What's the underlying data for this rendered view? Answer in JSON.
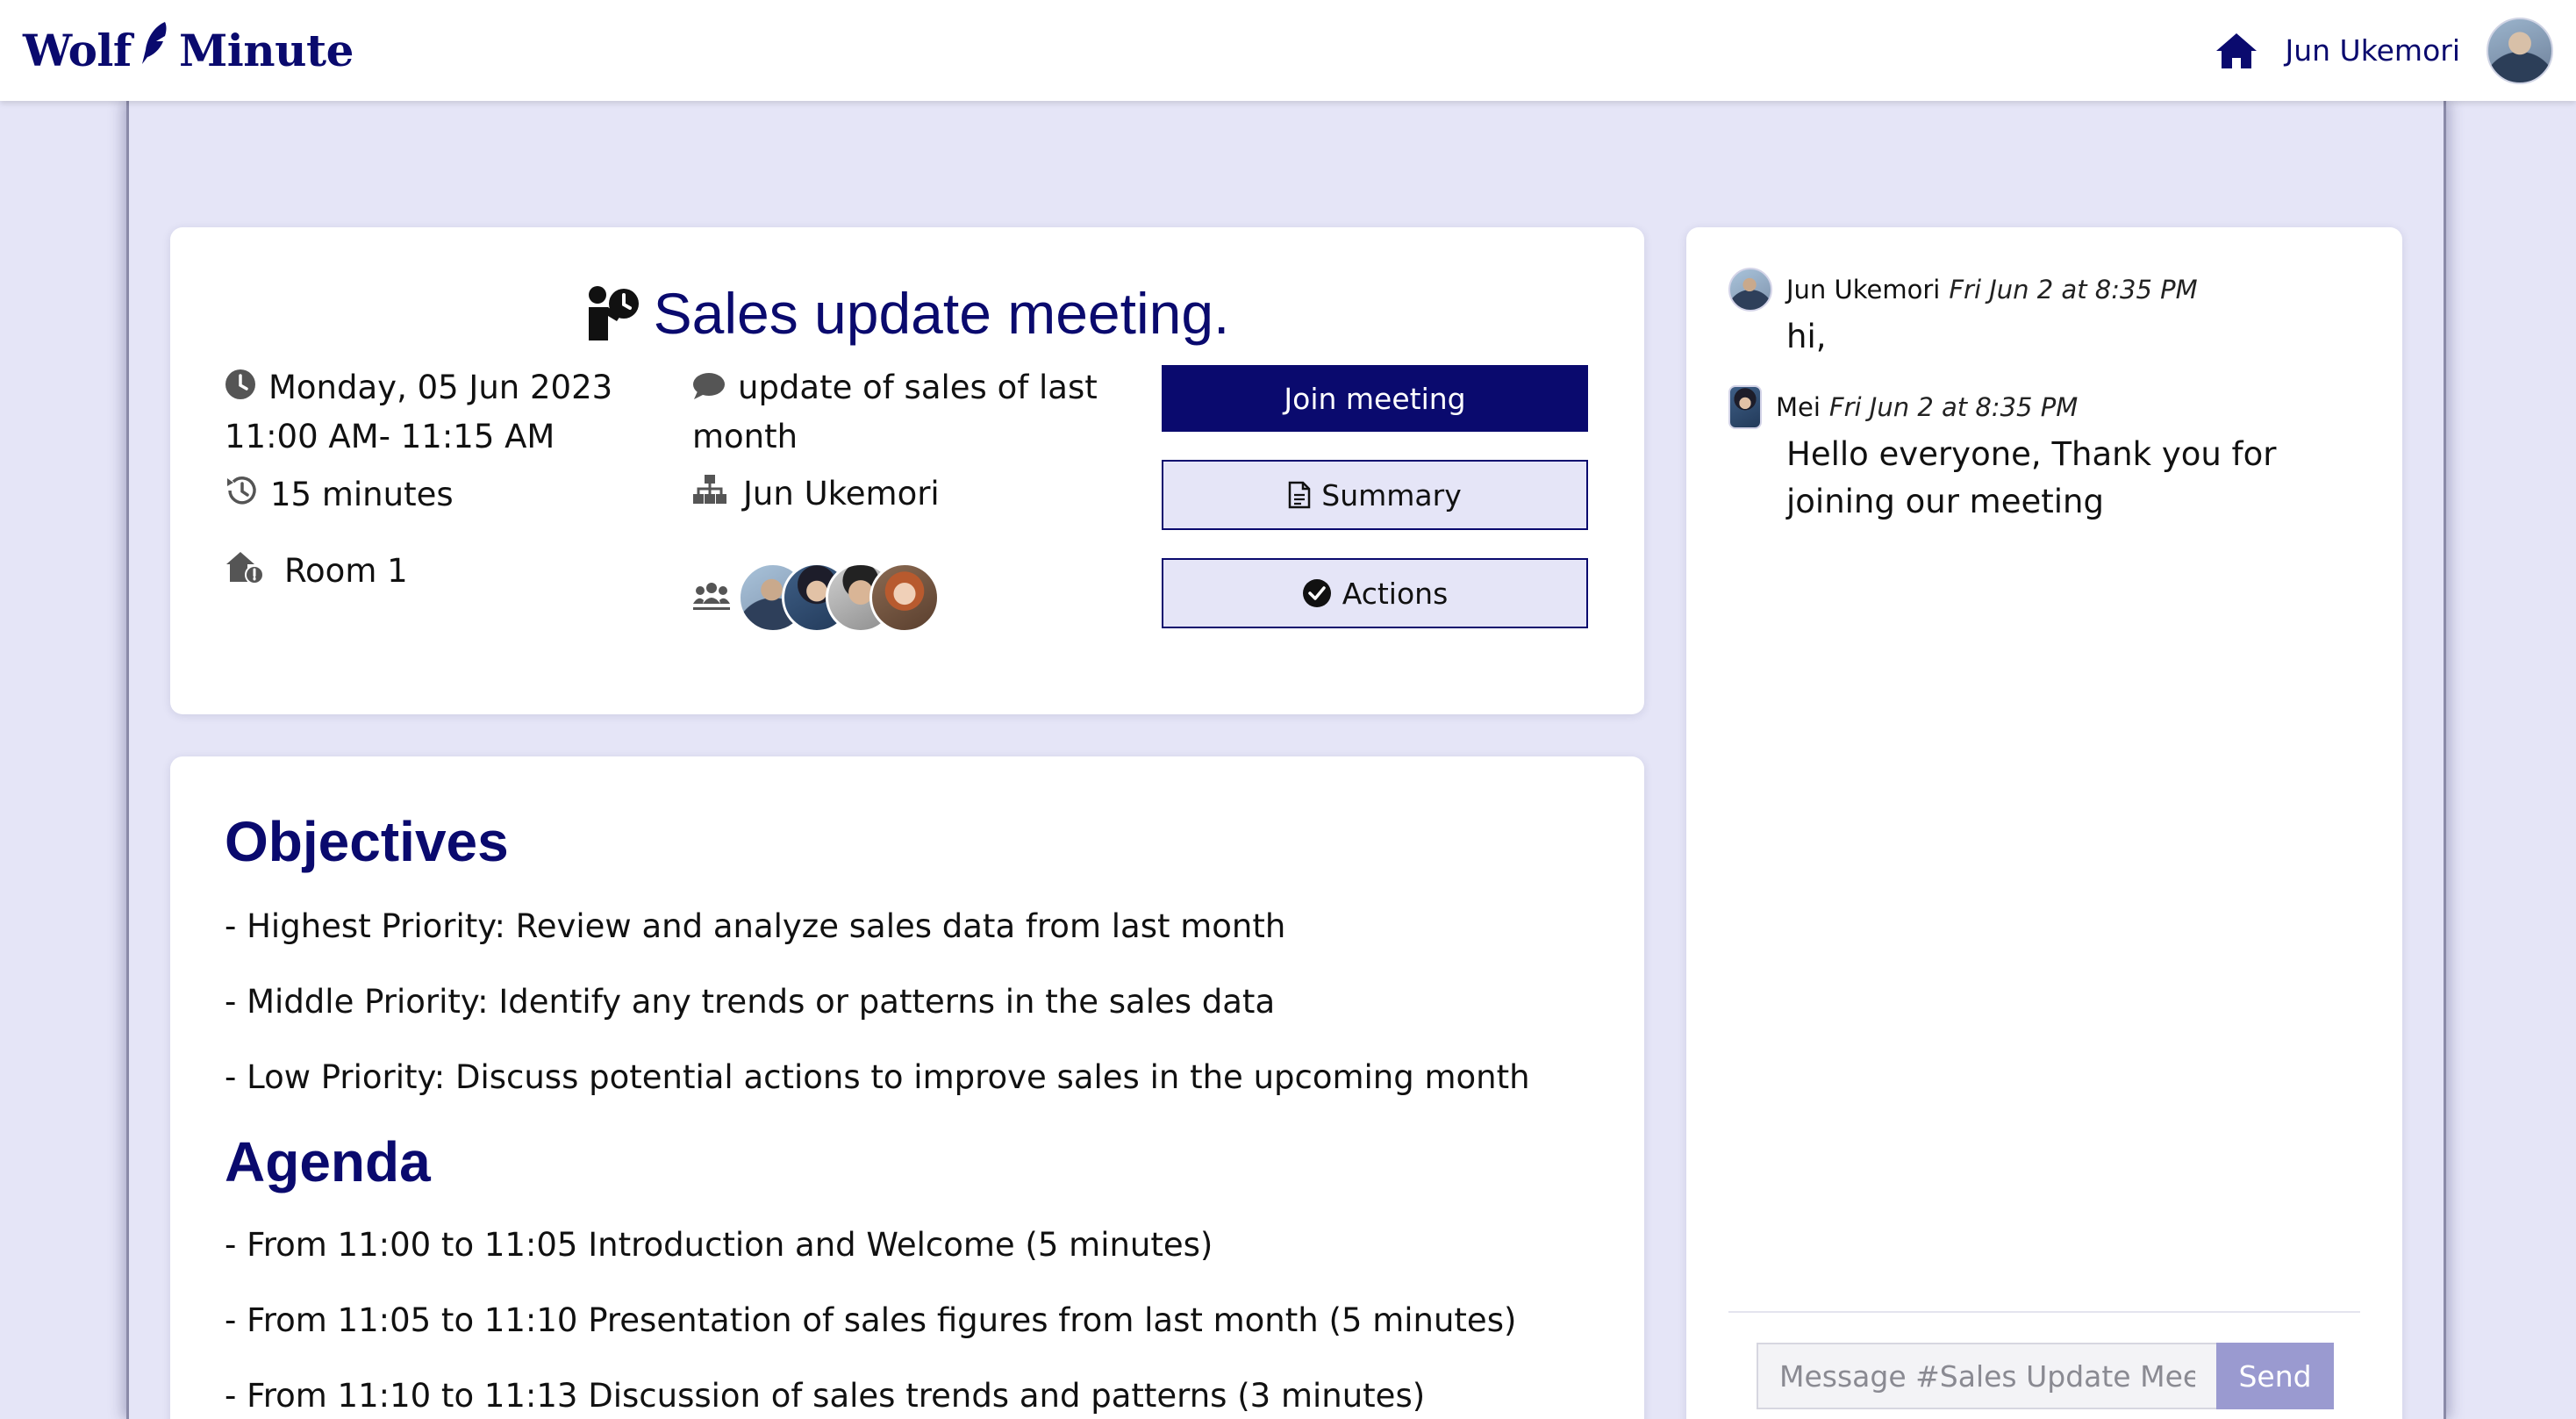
{
  "brand": {
    "name_left": "Wolf",
    "name_right": "Minute"
  },
  "nav": {
    "user_name": "Jun Ukemori"
  },
  "meeting": {
    "title": "Sales update meeting.",
    "date": "Monday, 05 Jun 2023",
    "time": "11:00 AM- 11:15 AM",
    "duration": "15 minutes",
    "room": "Room 1",
    "description": "update of sales of last month",
    "organizer": "Jun Ukemori",
    "participant_count": 4
  },
  "buttons": {
    "join": "Join meeting",
    "summary": "Summary",
    "actions": "Actions"
  },
  "objectives": {
    "title": "Objectives",
    "items": [
      "- Highest Priority: Review and analyze sales data from last month",
      "- Middle Priority: Identify any trends or patterns in the sales data",
      "- Low Priority: Discuss potential actions to improve sales in the upcoming month"
    ]
  },
  "agenda": {
    "title": "Agenda",
    "items": [
      "- From 11:00 to 11:05 Introduction and Welcome (5 minutes)",
      "- From 11:05 to 11:10 Presentation of sales figures from last month (5 minutes)",
      "- From 11:10 to 11:13 Discussion of sales trends and patterns (3 minutes)"
    ]
  },
  "chat": {
    "messages": [
      {
        "author": "Jun Ukemori",
        "time": "Fri Jun 2 at 8:35 PM",
        "text": "hi,"
      },
      {
        "author": "Mei",
        "time": "Fri Jun 2 at 8:35 PM",
        "text": "Hello everyone, Thank you for joining our meeting"
      }
    ],
    "input_placeholder": "Message #Sales Update Meeting",
    "send_label": "Send"
  },
  "colors": {
    "brand_navy": "#0a0a6e",
    "page_bg": "#e5e5f7",
    "send_button": "#9a9ad0"
  },
  "icons": {
    "brand": "quill-icon",
    "home": "home-icon",
    "title": "presenter-clock-icon",
    "date": "clock-icon",
    "duration": "history-icon",
    "room": "room-alert-icon",
    "description": "comment-icon",
    "organizer": "sitemap-icon",
    "participants": "users-icon",
    "summary": "document-icon",
    "actions": "check-circle-icon"
  }
}
